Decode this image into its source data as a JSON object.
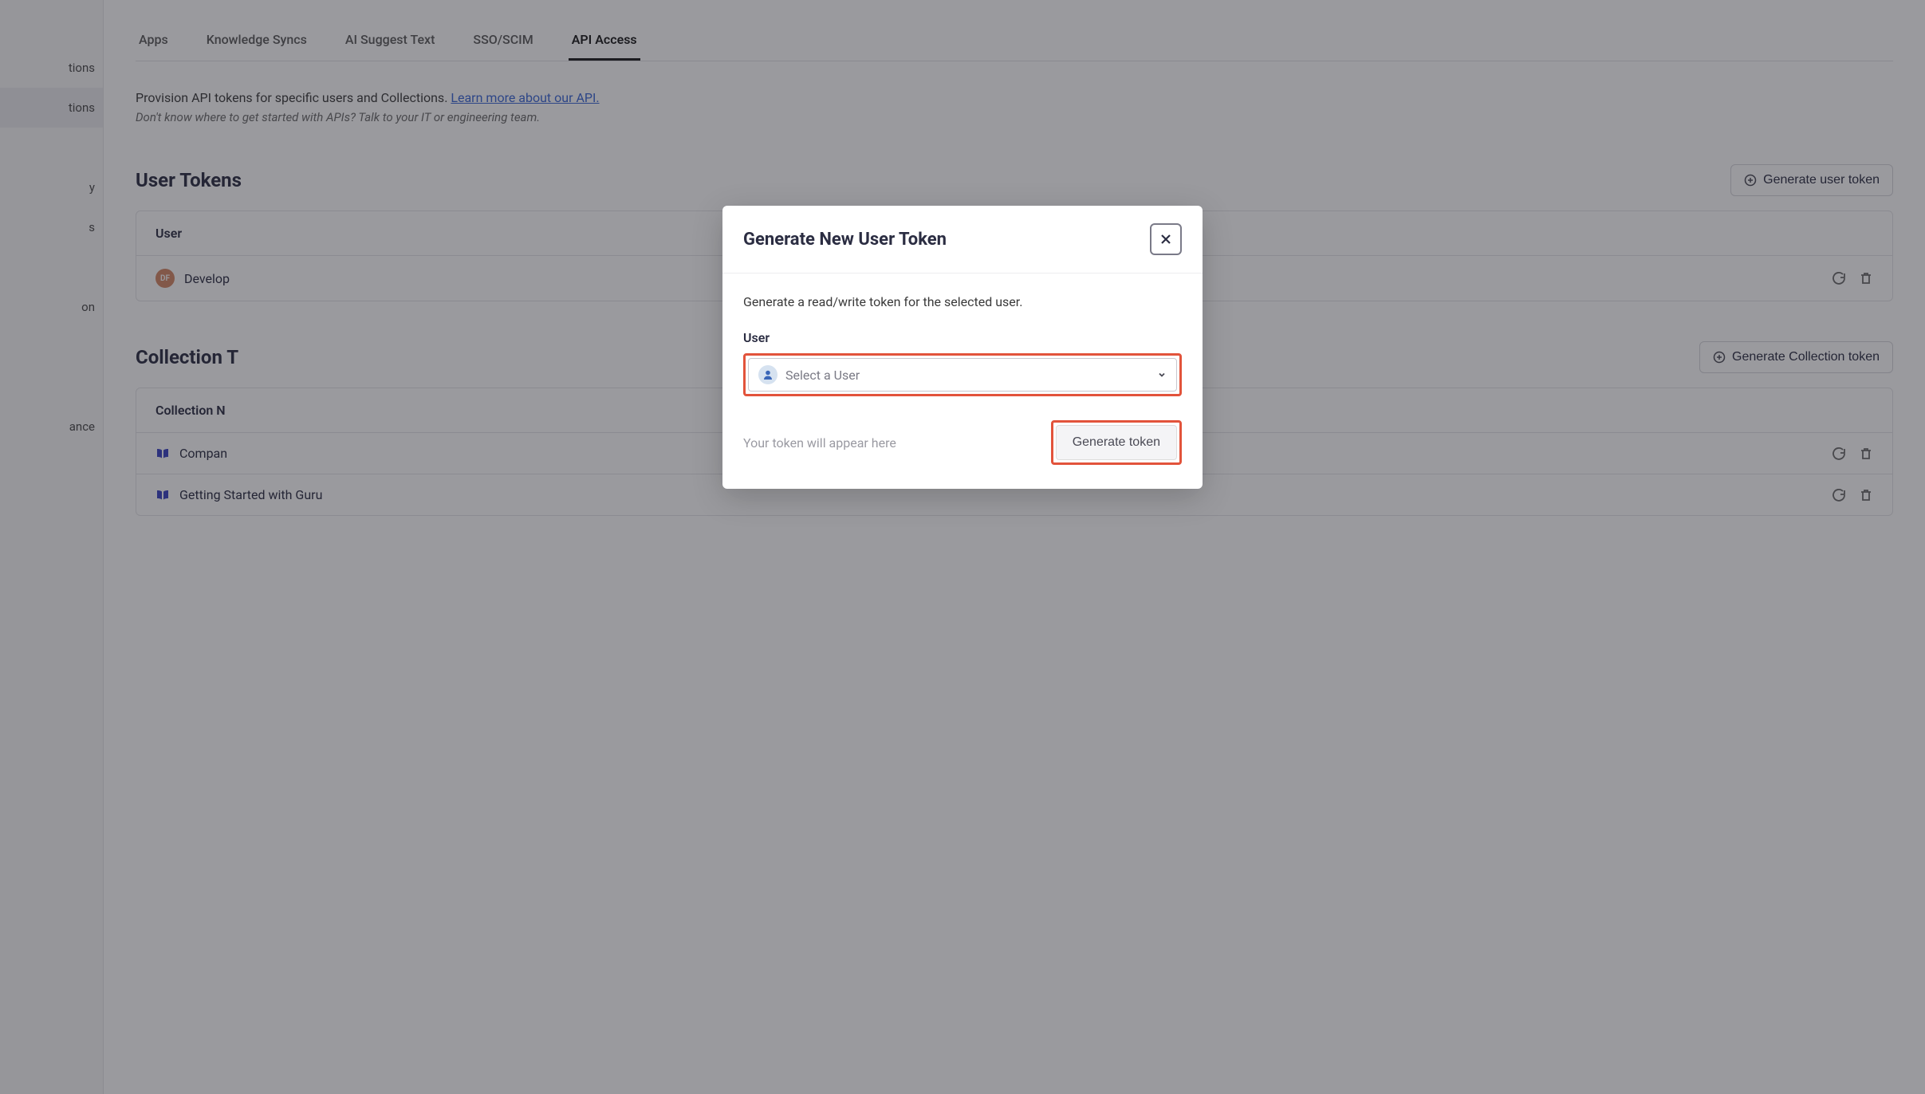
{
  "sidebar": {
    "items": [
      {
        "label": "tions"
      },
      {
        "label": "tions"
      },
      {
        "label": "y"
      },
      {
        "label": "s"
      },
      {
        "label": "on"
      },
      {
        "label": "ance"
      }
    ]
  },
  "tabs": [
    {
      "label": "Apps",
      "active": false
    },
    {
      "label": "Knowledge Syncs",
      "active": false
    },
    {
      "label": "AI Suggest Text",
      "active": false
    },
    {
      "label": "SSO/SCIM",
      "active": false
    },
    {
      "label": "API Access",
      "active": true
    }
  ],
  "description": {
    "main": "Provision API tokens for specific users and Collections. ",
    "link": "Learn more about our API.",
    "sub": "Don't know where to get started with APIs? Talk to your IT or engineering team."
  },
  "userTokens": {
    "title": "User Tokens",
    "button": "Generate user token",
    "header": "User",
    "rows": [
      {
        "initials": "DF",
        "label": "Develop"
      }
    ]
  },
  "collectionTokens": {
    "title": "Collection T",
    "button": "Generate Collection token",
    "header": "Collection N",
    "rows": [
      {
        "label": "Compan"
      },
      {
        "label": "Getting Started with Guru"
      }
    ]
  },
  "modal": {
    "title": "Generate New User Token",
    "description": "Generate a read/write token for the selected user.",
    "userLabel": "User",
    "selectPlaceholder": "Select a User",
    "tokenPlaceholder": "Your token will appear here",
    "generateButton": "Generate token"
  }
}
